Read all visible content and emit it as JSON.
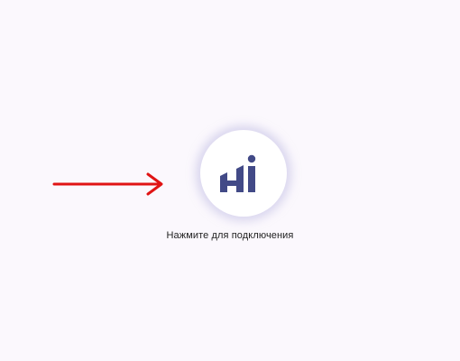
{
  "connect": {
    "label": "Нажмите для подключения",
    "logo_icon": "hi-bars-logo-icon",
    "logo_color": "#424a87"
  },
  "pointer": {
    "icon": "right-arrow-icon",
    "color": "#e01414"
  },
  "colors": {
    "background": "#fbf8fd",
    "button_bg": "#ffffff"
  }
}
